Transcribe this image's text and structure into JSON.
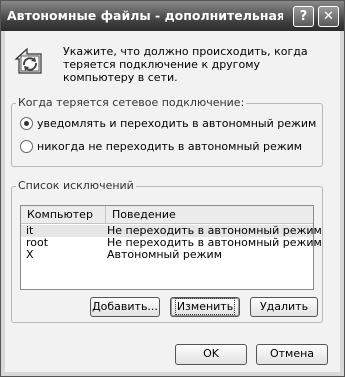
{
  "window": {
    "title": "Автономные файлы - дополнительная нас...",
    "help_button": "?",
    "close_button": "✕"
  },
  "message": "Укажите, что должно происходить, когда теряется подключение к другому компьютеру в сети.",
  "connection_group": {
    "label": "Когда теряется сетевое подключение:",
    "options": [
      {
        "label": "уведомлять и переходить в автономный режим",
        "selected": true
      },
      {
        "label": "никогда не переходить в автономный режим",
        "selected": false
      }
    ]
  },
  "exceptions_group": {
    "label": "Список исключений",
    "columns": [
      "Компьютер",
      "Поведение"
    ],
    "rows": [
      {
        "computer": "it",
        "behavior": "Не переходить в автономный режим",
        "selected": true
      },
      {
        "computer": "root",
        "behavior": "Не переходить в автономный режим",
        "selected": false
      },
      {
        "computer": "X",
        "behavior": "Автономный режим",
        "selected": false
      }
    ],
    "buttons": {
      "add": "Добавить...",
      "edit": "Изменить",
      "remove": "Удалить"
    }
  },
  "footer": {
    "ok": "OK",
    "cancel": "Отмена"
  }
}
